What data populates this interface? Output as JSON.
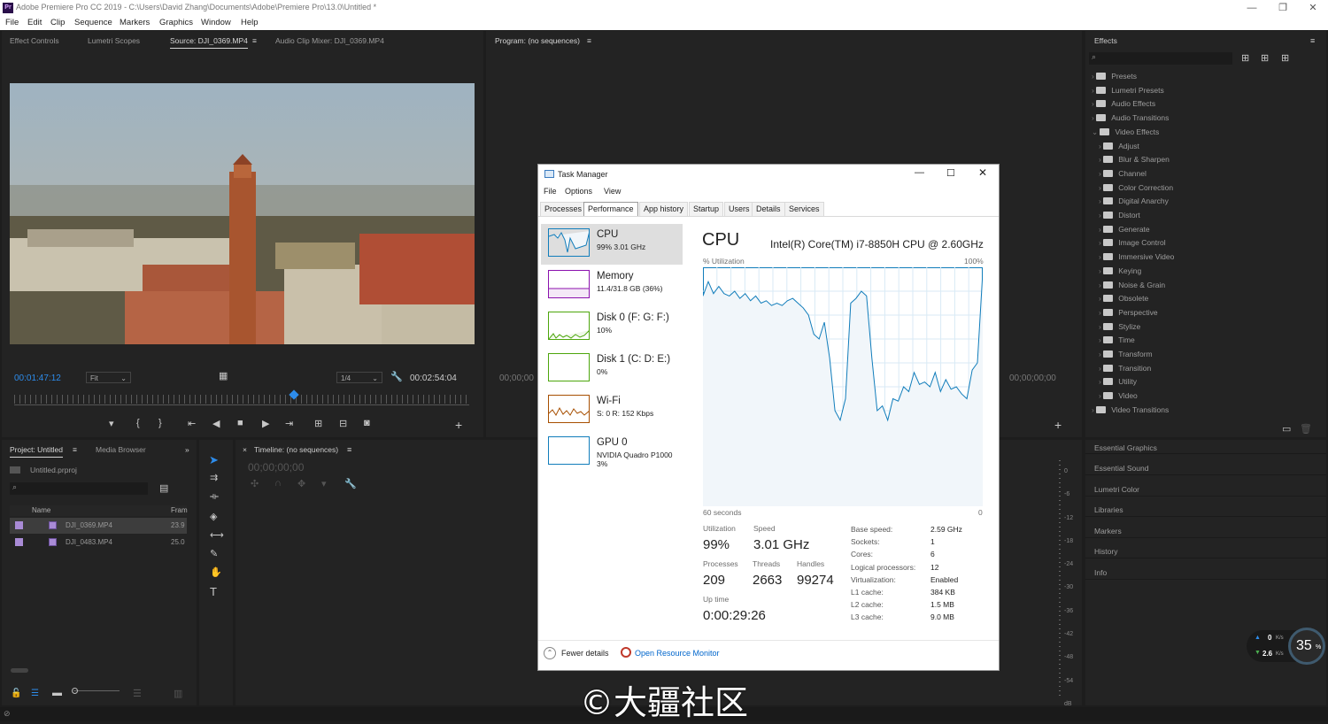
{
  "app": {
    "title": "Adobe Premiere Pro CC 2019 - C:\\Users\\David Zhang\\Documents\\Adobe\\Premiere Pro\\13.0\\Untitled *",
    "icon": "Pr"
  },
  "menu": [
    "File",
    "Edit",
    "Clip",
    "Sequence",
    "Markers",
    "Graphics",
    "Window",
    "Help"
  ],
  "source_panel": {
    "tabs": [
      "Effect Controls",
      "Lumetri Scopes",
      "Source: DJI_0369.MP4",
      "Audio Clip Mixer: DJI_0369.MP4"
    ],
    "timecode": "00:01:47:12",
    "fit": "Fit",
    "resolution": "1/4",
    "duration": "00:02:54:04"
  },
  "program_panel": {
    "tab": "Program: (no sequences)",
    "tc_left": "00;00;00",
    "tc_right": "00;00;00;00"
  },
  "project_panel": {
    "tabs": [
      "Project: Untitled",
      "Media Browser"
    ],
    "file": "Untitled.prproj",
    "col_name": "Name",
    "col_fr": "Fram",
    "items": [
      {
        "name": "DJI_0369.MP4",
        "fr": "23.9"
      },
      {
        "name": "DJI_0483.MP4",
        "fr": "25.0"
      }
    ]
  },
  "timeline": {
    "tab": "Timeline: (no sequences)",
    "timecode": "00;00;00;00"
  },
  "effects": {
    "title": "Effects",
    "tree": [
      {
        "label": "Presets",
        "level": 0,
        "open": false
      },
      {
        "label": "Lumetri Presets",
        "level": 0,
        "open": false
      },
      {
        "label": "Audio Effects",
        "level": 0,
        "open": false
      },
      {
        "label": "Audio Transitions",
        "level": 0,
        "open": false
      },
      {
        "label": "Video Effects",
        "level": 0,
        "open": true
      },
      {
        "label": "Adjust",
        "level": 1
      },
      {
        "label": "Blur & Sharpen",
        "level": 1
      },
      {
        "label": "Channel",
        "level": 1
      },
      {
        "label": "Color Correction",
        "level": 1
      },
      {
        "label": "Digital Anarchy",
        "level": 1
      },
      {
        "label": "Distort",
        "level": 1
      },
      {
        "label": "Generate",
        "level": 1
      },
      {
        "label": "Image Control",
        "level": 1
      },
      {
        "label": "Immersive Video",
        "level": 1
      },
      {
        "label": "Keying",
        "level": 1
      },
      {
        "label": "Noise & Grain",
        "level": 1
      },
      {
        "label": "Obsolete",
        "level": 1
      },
      {
        "label": "Perspective",
        "level": 1
      },
      {
        "label": "Stylize",
        "level": 1
      },
      {
        "label": "Time",
        "level": 1
      },
      {
        "label": "Transform",
        "level": 1
      },
      {
        "label": "Transition",
        "level": 1
      },
      {
        "label": "Utility",
        "level": 1
      },
      {
        "label": "Video",
        "level": 1
      },
      {
        "label": "Video Transitions",
        "level": 0,
        "open": false
      }
    ]
  },
  "side_panels": [
    "Essential Graphics",
    "Essential Sound",
    "Lumetri Color",
    "Libraries",
    "Markers",
    "History",
    "Info"
  ],
  "meter": {
    "labels": [
      "0",
      "-6",
      "-12",
      "-18",
      "-24",
      "-30",
      "-36",
      "-42",
      "-48",
      "-54",
      "dB"
    ]
  },
  "netmon": {
    "up": "0",
    "up_unit": "K/s",
    "down": "2.6",
    "down_unit": "K/s",
    "percent": "35",
    "pct_sign": "%"
  },
  "task_manager": {
    "title": "Task Manager",
    "menu": [
      "File",
      "Options",
      "View"
    ],
    "tabs": [
      "Processes",
      "Performance",
      "App history",
      "Startup",
      "Users",
      "Details",
      "Services"
    ],
    "resources": [
      {
        "name": "CPU",
        "detail": "99% 3.01 GHz",
        "color": "#117dbb"
      },
      {
        "name": "Memory",
        "detail": "11.4/31.8 GB (36%)",
        "color": "#8b12ae"
      },
      {
        "name": "Disk 0 (F: G: F:)",
        "detail": "10%",
        "color": "#4da60c"
      },
      {
        "name": "Disk 1 (C: D: E:)",
        "detail": "0%",
        "color": "#4da60c"
      },
      {
        "name": "Wi-Fi",
        "detail": "S: 0 R: 152 Kbps",
        "color": "#a74f01"
      },
      {
        "name": "GPU 0",
        "detail": "NVIDIA Quadro P1000",
        "detail2": "3%",
        "color": "#117dbb"
      }
    ],
    "cpu_title": "CPU",
    "cpu_model": "Intel(R) Core(TM) i7-8850H CPU @ 2.60GHz",
    "graph": {
      "ylabel": "% Utilization",
      "ymax": "100%",
      "xlabel": "60 seconds",
      "xmin": "0"
    },
    "stats": {
      "util_label": "Utilization",
      "util": "99%",
      "speed_label": "Speed",
      "speed": "3.01 GHz",
      "proc_label": "Processes",
      "proc": "209",
      "thr_label": "Threads",
      "thr": "2663",
      "hnd_label": "Handles",
      "hnd": "99274",
      "up_label": "Up time",
      "up": "0:00:29:26"
    },
    "props": [
      [
        "Base speed:",
        "2.59 GHz"
      ],
      [
        "Sockets:",
        "1"
      ],
      [
        "Cores:",
        "6"
      ],
      [
        "Logical processors:",
        "12"
      ],
      [
        "Virtualization:",
        "Enabled"
      ],
      [
        "L1 cache:",
        "384 KB"
      ],
      [
        "L2 cache:",
        "1.5 MB"
      ],
      [
        "L3 cache:",
        "9.0 MB"
      ]
    ],
    "fewer": "Fewer details",
    "fewer_u": "d",
    "orm": "Open Resource Monitor"
  },
  "watermark": "©大疆社区",
  "colors": {
    "accent": "#2d8ceb",
    "cpu_line": "#117dbb",
    "cpu_fill": "#f1f6fa"
  }
}
